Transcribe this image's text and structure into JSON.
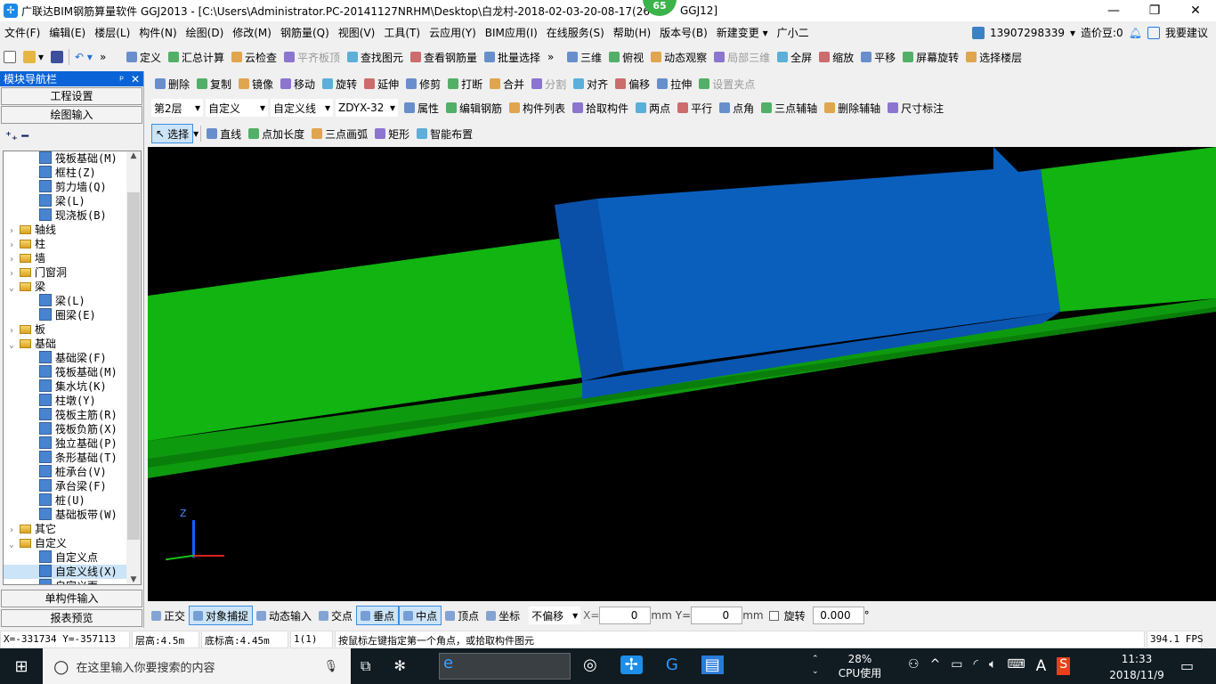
{
  "window": {
    "title": "广联达BIM钢筋算量软件 GGJ2013 - [C:\\Users\\Administrator.PC-20141127NRHM\\Desktop\\白龙村-2018-02-03-20-08-17(26",
    "title_suffix": "GGJ12]",
    "badge": "65",
    "minimize": "—",
    "maximize": "❐",
    "close": "✕"
  },
  "menu": [
    "文件(F)",
    "编辑(E)",
    "楼层(L)",
    "构件(N)",
    "绘图(D)",
    "修改(M)",
    "钢筋量(Q)",
    "视图(V)",
    "工具(T)",
    "云应用(Y)",
    "BIM应用(I)",
    "在线服务(S)",
    "帮助(H)",
    "版本号(B)",
    "新建变更 ▾",
    "广小二"
  ],
  "account": {
    "phone": "13907298339",
    "coins": "造价豆:0",
    "suggest": "我要建议"
  },
  "toolbar1": {
    "left": [
      "定义",
      "汇总计算",
      "云检查",
      "平齐板顶",
      "查找图元",
      "查看钢筋量",
      "批量选择"
    ],
    "right": [
      "三维",
      "俯视",
      "动态观察",
      "局部三维",
      "全屏",
      "缩放",
      "平移",
      "屏幕旋转",
      "选择楼层"
    ]
  },
  "toolbar2": [
    "删除",
    "复制",
    "镜像",
    "移动",
    "旋转",
    "延伸",
    "修剪",
    "打断",
    "合并",
    "分割",
    "对齐",
    "偏移",
    "拉伸",
    "设置夹点"
  ],
  "toolbar3": {
    "floor": "第2层",
    "type": "自定义",
    "subtype": "自定义线",
    "component": "ZDYX-32",
    "buttons": [
      "属性",
      "编辑钢筋",
      "构件列表",
      "拾取构件",
      "两点",
      "平行",
      "点角",
      "三点辅轴",
      "删除辅轴",
      "尺寸标注"
    ]
  },
  "toolbar4": {
    "select": "选择",
    "buttons": [
      "直线",
      "点加长度",
      "三点画弧",
      "矩形",
      "智能布置"
    ]
  },
  "nav": {
    "title": "模块导航栏",
    "pin": "ᵖ",
    "close": "✕",
    "project": "工程设置",
    "draw": "绘图输入",
    "single": "单构件输入",
    "report": "报表预览",
    "tree": [
      {
        "label": "筏板基础(M)",
        "level": 2
      },
      {
        "label": "框柱(Z)",
        "level": 2
      },
      {
        "label": "剪力墙(Q)",
        "level": 2
      },
      {
        "label": "梁(L)",
        "level": 2
      },
      {
        "label": "现浇板(B)",
        "level": 2
      },
      {
        "label": "轴线",
        "level": 1,
        "folder": true,
        "open": false
      },
      {
        "label": "柱",
        "level": 1,
        "folder": true,
        "open": false
      },
      {
        "label": "墙",
        "level": 1,
        "folder": true,
        "open": false
      },
      {
        "label": "门窗洞",
        "level": 1,
        "folder": true,
        "open": false
      },
      {
        "label": "梁",
        "level": 1,
        "folder": true,
        "open": true
      },
      {
        "label": "梁(L)",
        "level": 2
      },
      {
        "label": "圈梁(E)",
        "level": 2
      },
      {
        "label": "板",
        "level": 1,
        "folder": true,
        "open": false
      },
      {
        "label": "基础",
        "level": 1,
        "folder": true,
        "open": true
      },
      {
        "label": "基础梁(F)",
        "level": 2
      },
      {
        "label": "筏板基础(M)",
        "level": 2
      },
      {
        "label": "集水坑(K)",
        "level": 2
      },
      {
        "label": "柱墩(Y)",
        "level": 2
      },
      {
        "label": "筏板主筋(R)",
        "level": 2
      },
      {
        "label": "筏板负筋(X)",
        "level": 2
      },
      {
        "label": "独立基础(P)",
        "level": 2
      },
      {
        "label": "条形基础(T)",
        "level": 2
      },
      {
        "label": "桩承台(V)",
        "level": 2
      },
      {
        "label": "承台梁(F)",
        "level": 2
      },
      {
        "label": "桩(U)",
        "level": 2
      },
      {
        "label": "基础板带(W)",
        "level": 2
      },
      {
        "label": "其它",
        "level": 1,
        "folder": true,
        "open": false
      },
      {
        "label": "自定义",
        "level": 1,
        "folder": true,
        "open": true
      },
      {
        "label": "自定义点",
        "level": 2
      },
      {
        "label": "自定义线(X)",
        "level": 2,
        "selected": true
      },
      {
        "label": "自定义面",
        "level": 2
      }
    ]
  },
  "snap": {
    "buttons": [
      "正交",
      "对象捕捉",
      "动态输入",
      "交点",
      "垂点",
      "中点",
      "顶点",
      "坐标"
    ],
    "offset": "不偏移",
    "x_label": "X=",
    "x": "0",
    "unit": "mm",
    "y_label": "Y=",
    "y": "0",
    "rotate": "旋转",
    "angle": "0.000",
    "deg": "°"
  },
  "axis": {
    "z": "Z"
  },
  "status": {
    "coords": "X=-331734 Y=-357113",
    "floor_height": "层高:4.5m",
    "base_height": "底标高:4.45m",
    "count": "1(1)",
    "hint": "按鼠标左键指定第一个角点，或拾取构件图元",
    "fps": "394.1 FPS"
  },
  "taskbar": {
    "search": "在这里输入你要搜索的内容",
    "cpu": "28%",
    "cpu_label": "CPU使用",
    "ime": "A",
    "time": "11:33",
    "date": "2018/11/9"
  },
  "colors": {
    "green": "#11b411",
    "blue": "#0a5fbd",
    "nav_header": "#0a64d8"
  }
}
